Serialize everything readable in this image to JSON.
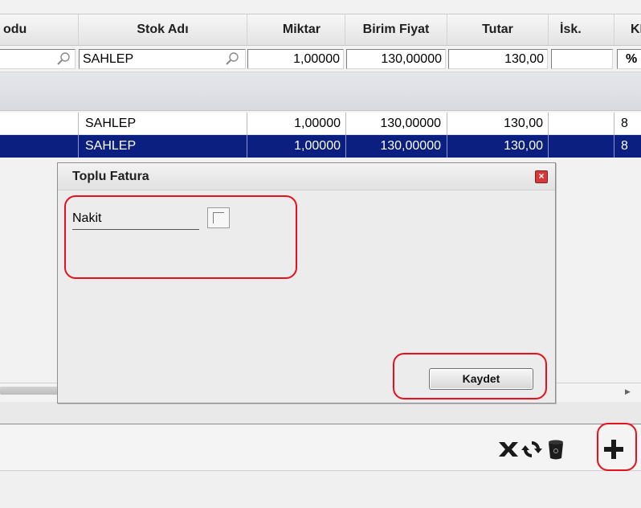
{
  "grid": {
    "columns": [
      "odu",
      "Stok Adı",
      "Miktar",
      "Birim Fiyat",
      "Tutar",
      "İsk.",
      "KD"
    ],
    "filter": {
      "stok_adi": "SAHLEP",
      "miktar": "1,00000",
      "birim_fiyat": "130,00000",
      "tutar": "130,00",
      "isk": "",
      "kdv": "%"
    },
    "rows": [
      {
        "stok_adi": "SAHLEP",
        "miktar": "1,00000",
        "birim_fiyat": "130,00000",
        "tutar": "130,00",
        "isk": "",
        "kdv": "8"
      },
      {
        "stok_adi": "SAHLEP",
        "miktar": "1,00000",
        "birim_fiyat": "130,00000",
        "tutar": "130,00",
        "isk": "",
        "kdv": "8"
      }
    ]
  },
  "dialog": {
    "title": "Toplu Fatura",
    "nakit_label": "Nakit",
    "nakit_checked": false,
    "save_label": "Kaydet",
    "close_icon": "close-icon"
  },
  "toolbar": {
    "icons": [
      "cancel-x-icon",
      "refresh-icon",
      "trash-icon",
      "add-plus-icon"
    ]
  },
  "colors": {
    "selected_row": "#0a1f7f",
    "annotation": "#e8101a"
  }
}
